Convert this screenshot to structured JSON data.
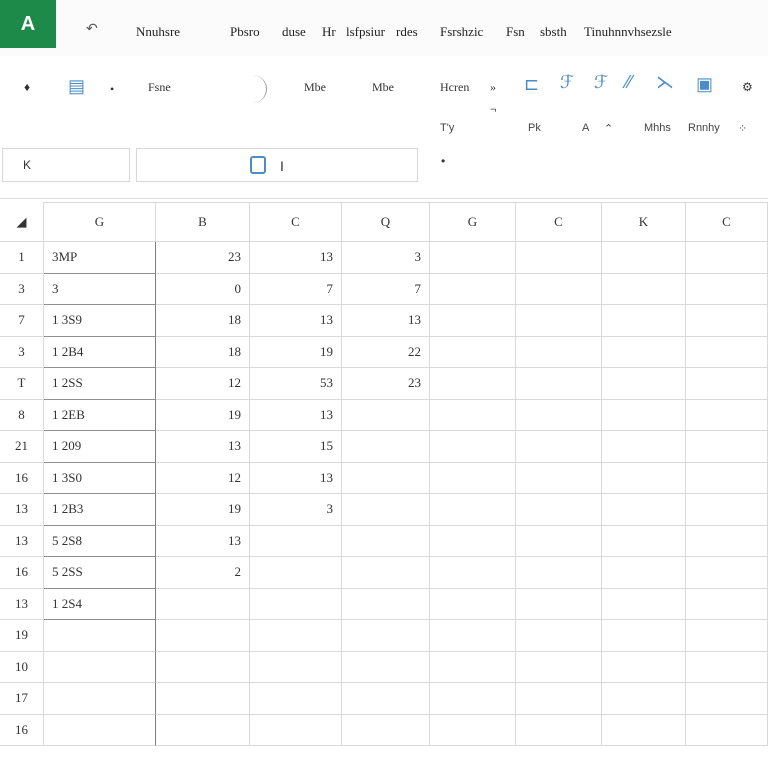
{
  "titlebar": {
    "logo": "A",
    "undo": "↶",
    "menu": [
      "Nnuhsre",
      "Pbsro",
      "duse",
      "Hr",
      "lsfpsiur",
      "rdes",
      "Fsrshzic",
      "Fsn",
      "sbsth",
      "Tinuhnnvhsezsle"
    ]
  },
  "ribbon": {
    "row1": [
      "♦",
      "Fsne",
      "Mbe",
      "Mbe",
      "Hcren",
      "»"
    ],
    "row2": [
      "T'y",
      "¬",
      "Pk",
      "A",
      "Mhhs",
      "Rnnhy"
    ]
  },
  "formula": {
    "name_box": "K",
    "cursor": "I",
    "dot": "•"
  },
  "grid": {
    "corner": "◢",
    "columns": [
      "G",
      "B",
      "C",
      "Q",
      "G",
      "C",
      "K",
      "C"
    ],
    "rows": [
      "1",
      "3",
      "7",
      "3",
      "T",
      "8",
      "21",
      "16",
      "13",
      "13",
      "16",
      "13",
      "19",
      "10",
      "17",
      "16"
    ],
    "cells": [
      [
        "3MP",
        "23",
        "13",
        "3"
      ],
      [
        "3",
        "0",
        "7",
        "7"
      ],
      [
        "1 3S9",
        "18",
        "13",
        "13"
      ],
      [
        "1 2B4",
        "18",
        "19",
        "22"
      ],
      [
        "1 2SS",
        "12",
        "53",
        "23"
      ],
      [
        "1 2EB",
        "19",
        "13",
        ""
      ],
      [
        "1 209",
        "13",
        "15",
        ""
      ],
      [
        "1 3S0",
        "12",
        "13",
        ""
      ],
      [
        "1 2B3",
        "19",
        "3",
        ""
      ],
      [
        "5 2S8",
        "13",
        "",
        ""
      ],
      [
        "5 2SS",
        "2",
        "",
        ""
      ],
      [
        "1 2S4",
        "",
        "",
        ""
      ],
      [
        "",
        "",
        "",
        ""
      ],
      [
        "",
        "",
        "",
        ""
      ],
      [
        "",
        "",
        "",
        ""
      ],
      [
        "",
        "",
        "",
        ""
      ]
    ]
  }
}
